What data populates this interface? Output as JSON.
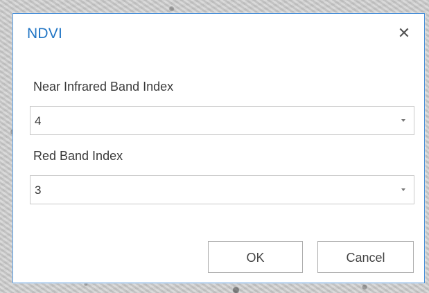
{
  "dialog": {
    "title": "NDVI",
    "close_icon": "close-icon",
    "nir_band": {
      "label": "Near Infrared Band Index",
      "value": "4"
    },
    "red_band": {
      "label": "Red Band Index",
      "value": "3"
    },
    "ok_label": "OK",
    "cancel_label": "Cancel"
  },
  "colors": {
    "title": "#1f74c4",
    "dialog_border": "#4a90d9",
    "field_border": "#c8c8c8"
  }
}
